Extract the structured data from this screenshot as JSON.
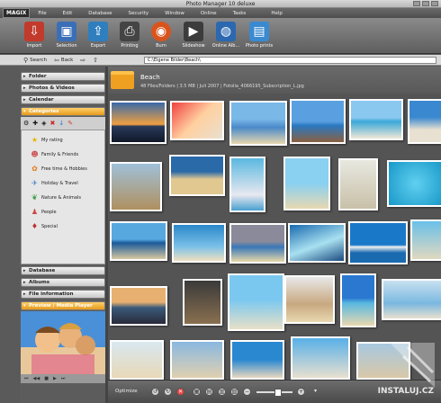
{
  "window": {
    "title": "Photo Manager 10 deluxe"
  },
  "menu": {
    "logo": "MAGIX",
    "items": [
      "File",
      "Edit",
      "Database",
      "Security",
      "Window",
      "Online",
      "Tasks",
      "Help"
    ]
  },
  "toolbar": {
    "buttons": [
      {
        "label": "Import",
        "icon": "import-icon",
        "color": "#c23a2c"
      },
      {
        "label": "Selection",
        "icon": "selection-icon",
        "color": "#3a6fb8"
      },
      {
        "label": "Export",
        "icon": "export-icon",
        "color": "#2f7fbf"
      },
      {
        "label": "Printing",
        "icon": "printer-icon",
        "color": "#444444"
      },
      {
        "label": "Burn",
        "icon": "burn-disc-icon",
        "color": "#d9541c"
      },
      {
        "label": "Slideshow",
        "icon": "slideshow-icon",
        "color": "#3c3c3c"
      },
      {
        "label": "Online Alb...",
        "icon": "online-album-icon",
        "color": "#2c68b0"
      },
      {
        "label": "Photo prints",
        "icon": "photo-prints-icon",
        "color": "#3a8ad0"
      }
    ]
  },
  "nav": {
    "search": "Search",
    "back": "Back",
    "path": "C:\\Eigene Bilder\\Beach\\"
  },
  "left_panel": {
    "headers": {
      "folder": "Folder",
      "photos_videos": "Photos & Videos",
      "calendar": "Calendar",
      "categories": "Categories",
      "database": "Database",
      "albums": "Albums",
      "file_information": "File information",
      "preview": "Preview / Media Player"
    },
    "categories": [
      {
        "label": "My rating",
        "icon": "star-rating-icon"
      },
      {
        "label": "Family & Friends",
        "icon": "family-icon"
      },
      {
        "label": "Free time & Hobbies",
        "icon": "hobbies-icon"
      },
      {
        "label": "Holiday & Travel",
        "icon": "travel-icon"
      },
      {
        "label": "Nature & Animals",
        "icon": "nature-icon"
      },
      {
        "label": "People",
        "icon": "people-icon"
      },
      {
        "label": "Special",
        "icon": "special-icon"
      }
    ]
  },
  "folder_info": {
    "name": "Beach",
    "meta": "48 Files/Folders | 3.5 MB | Juli 2007 | Fotolia_4066195_Subscription_L.jpg"
  },
  "bottom": {
    "optimize": "Optimize"
  },
  "watermark": {
    "text": "INSTALUJ.CZ"
  },
  "colors": {
    "accent": "#f0a020",
    "panel_bg": "#5c5c5c",
    "content_bg": "#545454"
  }
}
